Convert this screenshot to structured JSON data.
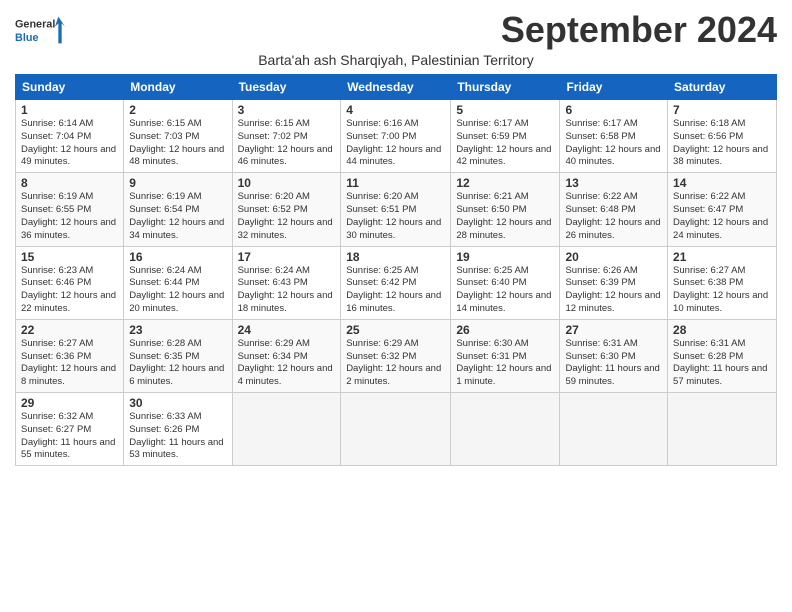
{
  "logo": {
    "line1": "General",
    "line2": "Blue"
  },
  "title": "September 2024",
  "subtitle": "Barta'ah ash Sharqiyah, Palestinian Territory",
  "days_header": [
    "Sunday",
    "Monday",
    "Tuesday",
    "Wednesday",
    "Thursday",
    "Friday",
    "Saturday"
  ],
  "weeks": [
    [
      {
        "num": "1",
        "rise": "6:14 AM",
        "set": "7:04 PM",
        "daylight": "12 hours and 49 minutes."
      },
      {
        "num": "2",
        "rise": "6:15 AM",
        "set": "7:03 PM",
        "daylight": "12 hours and 48 minutes."
      },
      {
        "num": "3",
        "rise": "6:15 AM",
        "set": "7:02 PM",
        "daylight": "12 hours and 46 minutes."
      },
      {
        "num": "4",
        "rise": "6:16 AM",
        "set": "7:00 PM",
        "daylight": "12 hours and 44 minutes."
      },
      {
        "num": "5",
        "rise": "6:17 AM",
        "set": "6:59 PM",
        "daylight": "12 hours and 42 minutes."
      },
      {
        "num": "6",
        "rise": "6:17 AM",
        "set": "6:58 PM",
        "daylight": "12 hours and 40 minutes."
      },
      {
        "num": "7",
        "rise": "6:18 AM",
        "set": "6:56 PM",
        "daylight": "12 hours and 38 minutes."
      }
    ],
    [
      {
        "num": "8",
        "rise": "6:19 AM",
        "set": "6:55 PM",
        "daylight": "12 hours and 36 minutes."
      },
      {
        "num": "9",
        "rise": "6:19 AM",
        "set": "6:54 PM",
        "daylight": "12 hours and 34 minutes."
      },
      {
        "num": "10",
        "rise": "6:20 AM",
        "set": "6:52 PM",
        "daylight": "12 hours and 32 minutes."
      },
      {
        "num": "11",
        "rise": "6:20 AM",
        "set": "6:51 PM",
        "daylight": "12 hours and 30 minutes."
      },
      {
        "num": "12",
        "rise": "6:21 AM",
        "set": "6:50 PM",
        "daylight": "12 hours and 28 minutes."
      },
      {
        "num": "13",
        "rise": "6:22 AM",
        "set": "6:48 PM",
        "daylight": "12 hours and 26 minutes."
      },
      {
        "num": "14",
        "rise": "6:22 AM",
        "set": "6:47 PM",
        "daylight": "12 hours and 24 minutes."
      }
    ],
    [
      {
        "num": "15",
        "rise": "6:23 AM",
        "set": "6:46 PM",
        "daylight": "12 hours and 22 minutes."
      },
      {
        "num": "16",
        "rise": "6:24 AM",
        "set": "6:44 PM",
        "daylight": "12 hours and 20 minutes."
      },
      {
        "num": "17",
        "rise": "6:24 AM",
        "set": "6:43 PM",
        "daylight": "12 hours and 18 minutes."
      },
      {
        "num": "18",
        "rise": "6:25 AM",
        "set": "6:42 PM",
        "daylight": "12 hours and 16 minutes."
      },
      {
        "num": "19",
        "rise": "6:25 AM",
        "set": "6:40 PM",
        "daylight": "12 hours and 14 minutes."
      },
      {
        "num": "20",
        "rise": "6:26 AM",
        "set": "6:39 PM",
        "daylight": "12 hours and 12 minutes."
      },
      {
        "num": "21",
        "rise": "6:27 AM",
        "set": "6:38 PM",
        "daylight": "12 hours and 10 minutes."
      }
    ],
    [
      {
        "num": "22",
        "rise": "6:27 AM",
        "set": "6:36 PM",
        "daylight": "12 hours and 8 minutes."
      },
      {
        "num": "23",
        "rise": "6:28 AM",
        "set": "6:35 PM",
        "daylight": "12 hours and 6 minutes."
      },
      {
        "num": "24",
        "rise": "6:29 AM",
        "set": "6:34 PM",
        "daylight": "12 hours and 4 minutes."
      },
      {
        "num": "25",
        "rise": "6:29 AM",
        "set": "6:32 PM",
        "daylight": "12 hours and 2 minutes."
      },
      {
        "num": "26",
        "rise": "6:30 AM",
        "set": "6:31 PM",
        "daylight": "12 hours and 1 minute."
      },
      {
        "num": "27",
        "rise": "6:31 AM",
        "set": "6:30 PM",
        "daylight": "11 hours and 59 minutes."
      },
      {
        "num": "28",
        "rise": "6:31 AM",
        "set": "6:28 PM",
        "daylight": "11 hours and 57 minutes."
      }
    ],
    [
      {
        "num": "29",
        "rise": "6:32 AM",
        "set": "6:27 PM",
        "daylight": "11 hours and 55 minutes."
      },
      {
        "num": "30",
        "rise": "6:33 AM",
        "set": "6:26 PM",
        "daylight": "11 hours and 53 minutes."
      },
      null,
      null,
      null,
      null,
      null
    ]
  ]
}
